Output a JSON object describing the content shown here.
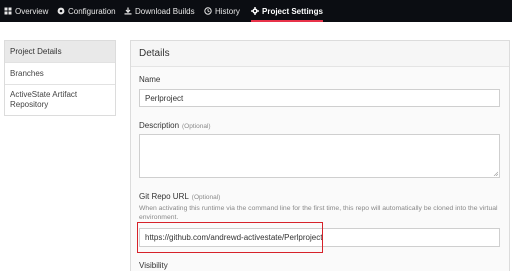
{
  "topnav": {
    "items": [
      {
        "label": "Overview",
        "icon": "grid-icon"
      },
      {
        "label": "Configuration",
        "icon": "settings-icon"
      },
      {
        "label": "Download Builds",
        "icon": "download-icon"
      },
      {
        "label": "History",
        "icon": "history-icon"
      },
      {
        "label": "Project Settings",
        "icon": "gear-icon",
        "active": true
      }
    ],
    "active_underline_color": "#e8334a"
  },
  "sidebar": {
    "items": [
      {
        "label": "Project Details",
        "active": true
      },
      {
        "label": "Branches"
      },
      {
        "label": "ActiveState Artifact Repository"
      }
    ]
  },
  "details": {
    "title": "Details",
    "name": {
      "label": "Name",
      "value": "Perlproject"
    },
    "description": {
      "label": "Description",
      "optional": "(Optional)",
      "value": ""
    },
    "git_repo_url": {
      "label": "Git Repo URL",
      "optional": "(Optional)",
      "help": "When activating this runtime via the command line for the first time, this repo will automatically be cloned into the virtual environment.",
      "value": "https://github.com/andrewd-activestate/Perlproject",
      "highlight_color": "#d6222a"
    },
    "visibility": {
      "label": "Visibility"
    }
  }
}
